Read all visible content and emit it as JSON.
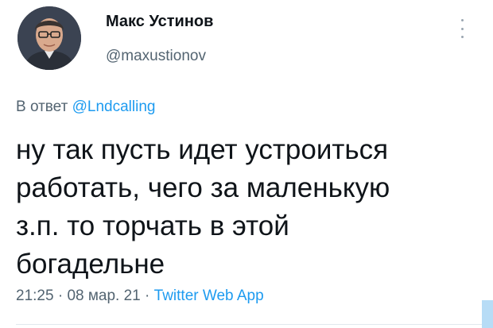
{
  "author": {
    "display_name": "Макс Устинов",
    "handle": "@maxustionov",
    "avatar_icon": "user-avatar"
  },
  "reply_to": {
    "prefix": "В ответ",
    "mention": "@Lndcalling"
  },
  "tweet": {
    "text_lines": [
      "ну так пусть идет устроиться",
      "работать, чего за маленькую",
      "з.п. то торчать в этой",
      "богадельне"
    ]
  },
  "meta": {
    "time": "21:25",
    "separator": "·",
    "date": "08 мар. 21",
    "source": "Twitter Web App"
  },
  "icons": {
    "more": "more-vertical-icon"
  },
  "colors": {
    "link": "#1d9bf0",
    "secondary_text": "#536471",
    "primary_text": "#0f1419"
  }
}
